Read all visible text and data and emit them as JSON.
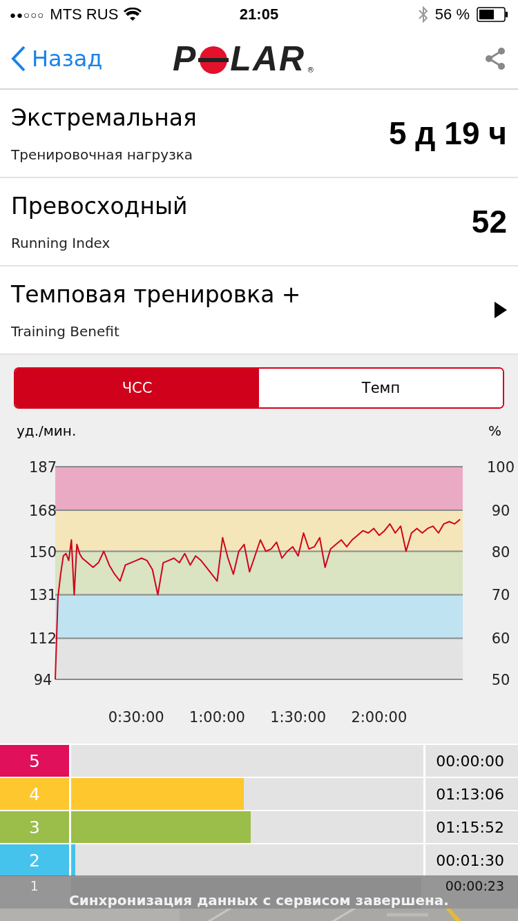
{
  "status_bar": {
    "signal": "●●○○○",
    "carrier": "MTS RUS",
    "time": "21:05",
    "battery": "56 %"
  },
  "nav": {
    "back": "Назад",
    "logo": {
      "before": "P",
      "after": "LAR",
      "mark": "®"
    }
  },
  "metrics": [
    {
      "title": "Экстремальная",
      "subtitle": "Тренировочная нагрузка",
      "value": "5 д 19 ч",
      "kind": "value"
    },
    {
      "title": "Превосходный",
      "subtitle": "Running Index",
      "value": "52",
      "kind": "value"
    },
    {
      "title": "Темповая тренировка +",
      "subtitle": "Training Benefit",
      "kind": "link"
    }
  ],
  "segments": [
    {
      "label": "ЧСС",
      "selected": true
    },
    {
      "label": "Темп",
      "selected": false
    }
  ],
  "chart": {
    "left_unit": "уд./мин.",
    "right_unit": "%",
    "right_ticks": [
      "100",
      "90",
      "80",
      "70",
      "60",
      "50"
    ],
    "chart_data": {
      "type": "line",
      "grid": true,
      "ylim": [
        94,
        187
      ],
      "bands": [
        {
          "axis": "y",
          "from": 168,
          "to": 187,
          "color": "#eaaac4"
        },
        {
          "axis": "y",
          "from": 150,
          "to": 168,
          "color": "#f4e6b9"
        },
        {
          "axis": "y",
          "from": 131,
          "to": 150,
          "color": "#dae3c2"
        },
        {
          "axis": "y",
          "from": 112,
          "to": 131,
          "color": "#bfe3f1"
        },
        {
          "axis": "y",
          "from": 94,
          "to": 112,
          "color": "#e3e3e3"
        }
      ],
      "yticks": [
        187,
        168,
        150,
        131,
        112,
        94
      ],
      "xlim": [
        0,
        151
      ],
      "xticks": [
        {
          "value": 30,
          "label": "0:30:00"
        },
        {
          "value": 60,
          "label": "1:00:00"
        },
        {
          "value": 90,
          "label": "1:30:00"
        },
        {
          "value": 120,
          "label": "2:00:00"
        }
      ],
      "x": [
        0,
        1,
        2,
        3,
        4,
        5,
        6,
        7,
        8,
        9,
        10,
        12,
        14,
        16,
        18,
        20,
        22,
        24,
        26,
        28,
        30,
        32,
        34,
        36,
        38,
        40,
        42,
        44,
        46,
        48,
        50,
        52,
        54,
        56,
        58,
        60,
        62,
        64,
        66,
        68,
        70,
        72,
        74,
        76,
        78,
        80,
        82,
        84,
        86,
        88,
        90,
        92,
        94,
        96,
        98,
        100,
        102,
        104,
        106,
        108,
        110,
        112,
        114,
        116,
        118,
        120,
        122,
        124,
        126,
        128,
        130,
        132,
        134,
        136,
        138,
        140,
        142,
        144,
        146,
        148,
        150
      ],
      "series": [
        {
          "color": "#d0021b",
          "values": [
            94,
            130,
            140,
            148,
            149,
            146,
            155,
            131,
            153,
            149,
            147,
            145,
            143,
            145,
            150,
            144,
            140,
            137,
            144,
            145,
            146,
            147,
            146,
            142,
            131,
            145,
            146,
            147,
            145,
            149,
            144,
            148,
            146,
            143,
            140,
            137,
            156,
            147,
            140,
            150,
            153,
            141,
            148,
            155,
            150,
            151,
            154,
            147,
            150,
            152,
            148,
            158,
            151,
            152,
            156,
            143,
            151,
            153,
            155,
            152,
            155,
            157,
            159,
            158,
            160,
            157,
            159,
            162,
            158,
            161,
            150,
            158,
            160,
            158,
            160,
            161,
            158,
            162,
            163,
            162,
            164
          ]
        }
      ]
    }
  },
  "zones": [
    {
      "number": "5",
      "color": "#e0105a",
      "time": "00:00:00"
    },
    {
      "number": "4",
      "color": "#fec72e",
      "level": 0.49,
      "time": "01:13:06"
    },
    {
      "number": "3",
      "color": "#9bbd4a",
      "level": 0.51,
      "time": "01:15:52"
    },
    {
      "number": "2",
      "color": "#45c3ec",
      "level": 0.012,
      "time": "00:01:30"
    },
    {
      "number": "1",
      "time": "00:00:23"
    }
  ],
  "toast": "Синхронизация данных с сервисом завершена."
}
